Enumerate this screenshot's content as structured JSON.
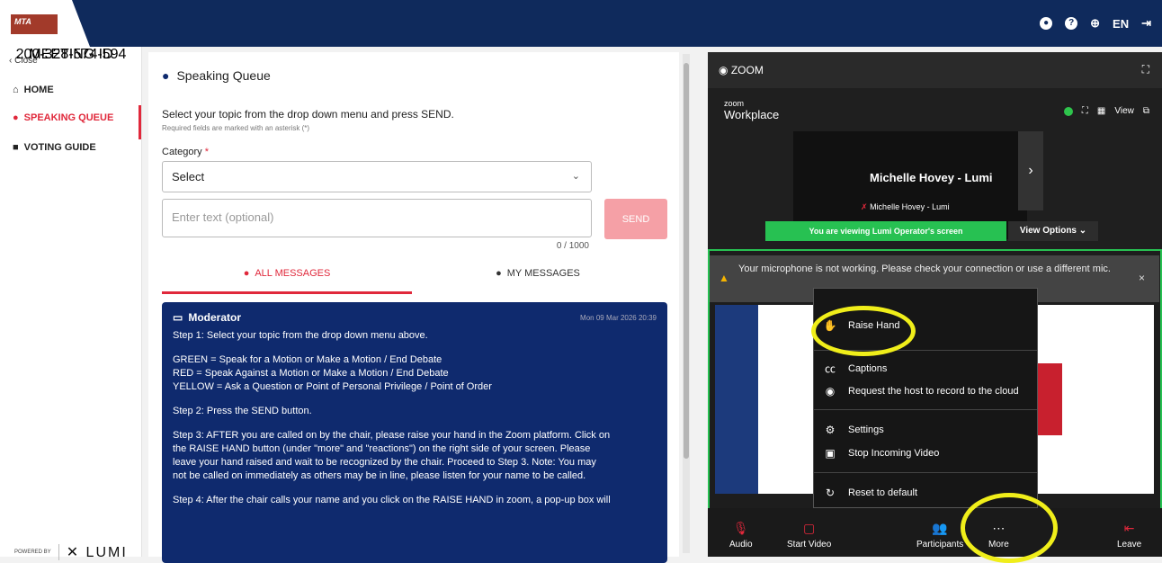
{
  "header": {
    "logo_text": "MTA",
    "lang": "EN"
  },
  "sidebar": {
    "close": "Close",
    "items": [
      {
        "label": "HOME"
      },
      {
        "label": "SPEAKING QUEUE"
      },
      {
        "label": "VOTING GUIDE"
      }
    ],
    "meeting_id_label": "MEETING ID",
    "meeting_id": "200-328-574-594",
    "powered_by": "POWERED BY",
    "brand": "LUMI"
  },
  "main": {
    "title": "Speaking Queue",
    "instruction": "Select your topic from the drop down menu and press SEND.",
    "required_note": "Required fields are marked with an asterisk (*)",
    "category_label": "Category",
    "category_star": "*",
    "select_value": "Select",
    "text_placeholder": "Enter text (optional)",
    "counter": "0 / 1000",
    "send_label": "SEND",
    "tabs": [
      {
        "label": "ALL MESSAGES"
      },
      {
        "label": "MY MESSAGES"
      }
    ],
    "message": {
      "author": "Moderator",
      "date": "Mon 09 Mar 2026 20:39",
      "lines": [
        "Step 1: Select your topic from the drop down menu above.",
        "GREEN = Speak for a Motion or Make a Motion / End Debate",
        "RED = Speak Against a Motion or Make a Motion / End Debate",
        "YELLOW = Ask a Question or Point of Personal Privilege / Point of Order",
        "Step 2: Press the SEND button.",
        "Step 3: AFTER you are called on by the chair, please raise your hand in the Zoom platform. Click on",
        "the RAISE HAND button (under \"more\" and \"reactions\") on the right side of your screen. Please",
        "leave your hand raised and wait to be recognized by the chair. Proceed to Step 3. Note: You may",
        "not be called on immediately as others may be in line, please listen for your name to be called.",
        "Step 4: After the chair calls your name and you click on the RAISE HAND in zoom, a pop-up box will"
      ]
    }
  },
  "zoom": {
    "header": "ZOOM",
    "brand_small": "zoom",
    "brand_big": "Workplace",
    "view_label": "View",
    "speaker_name": "Michelle Hovey - Lumi",
    "speaker_small": "Michelle Hovey - Lumi",
    "viewing_banner": "You are viewing  Lumi Operator's screen",
    "view_options": "View Options",
    "mic_warning": "Your microphone is not working. Please check your connection or use a different mic.",
    "menu": [
      {
        "label": "Raise Hand",
        "icon": "hand-icon"
      },
      {
        "label": "Captions",
        "icon": "cc-icon"
      },
      {
        "label": "Request the host to record to the cloud",
        "icon": "record-icon"
      },
      {
        "label": "Settings",
        "icon": "gear-icon"
      },
      {
        "label": "Stop Incoming Video",
        "icon": "video-icon"
      },
      {
        "label": "Reset to default",
        "icon": "reset-icon"
      }
    ],
    "toolbar": [
      {
        "label": "Audio"
      },
      {
        "label": "Start Video"
      },
      {
        "label": "Participants"
      },
      {
        "label": "More"
      },
      {
        "label": "Leave"
      }
    ]
  },
  "colors": {
    "navy": "#0f2a5c",
    "accent_red": "#e0283b",
    "zoom_green": "#27c152",
    "highlight": "#f0ee1a"
  }
}
